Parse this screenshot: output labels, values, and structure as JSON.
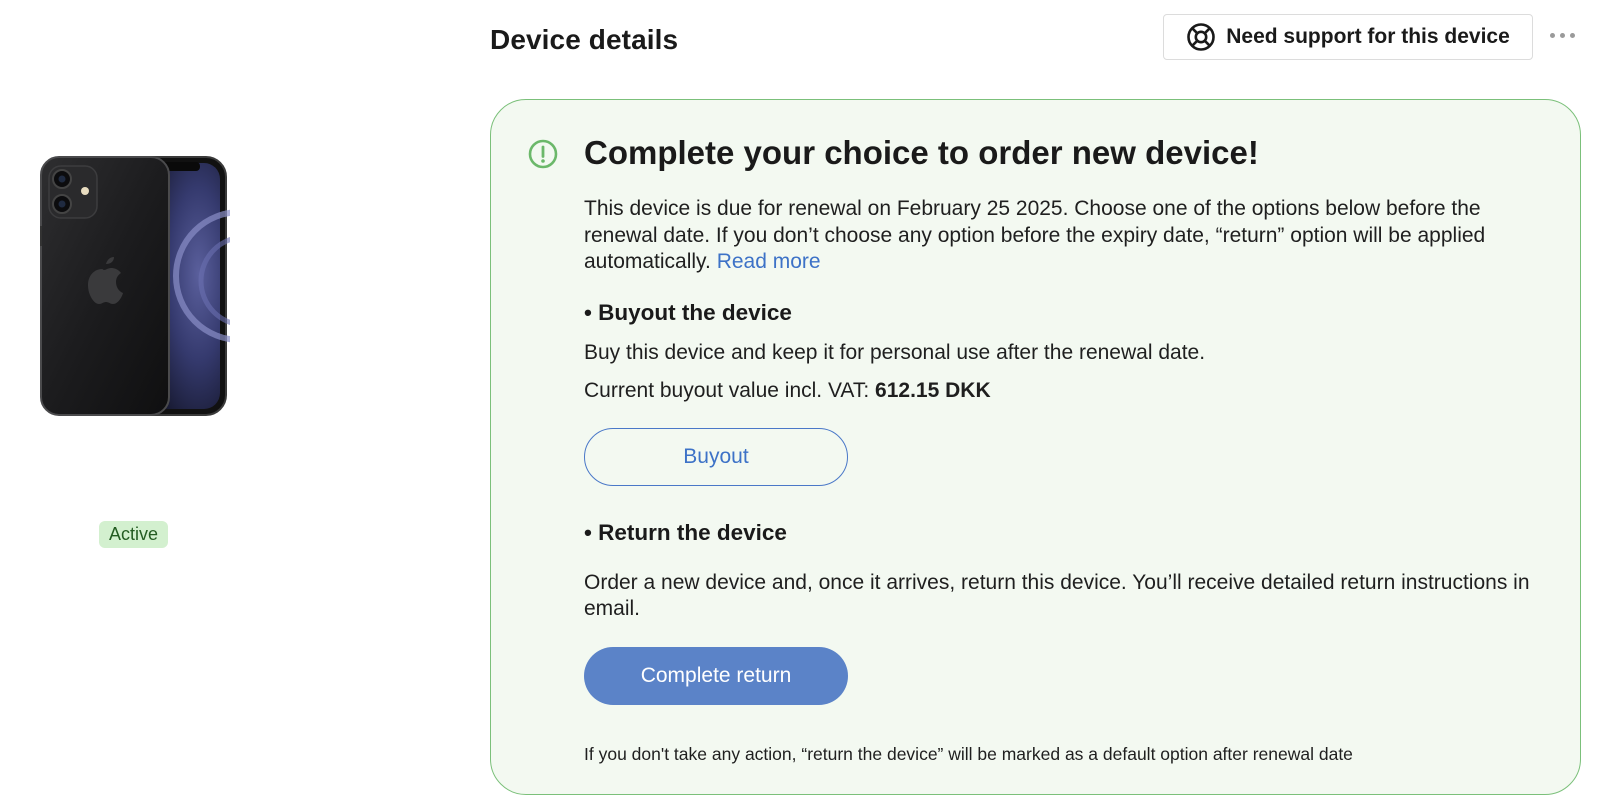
{
  "header": {
    "title": "Device details",
    "support_button_label": "Need support for this device",
    "support_icon": "lifebuoy-icon",
    "more_icon": "more-dots-icon"
  },
  "device": {
    "image_icon": "smartphone-image",
    "status": "Active",
    "status_color": "#d3f0cf"
  },
  "renewal_card": {
    "icon": "alert-circle-icon",
    "accent_color": "#7bc07a",
    "title": "Complete your choice to order new device!",
    "intro": "This device is due for renewal on February 25 2025. Choose one of the options below before the renewal date. If you don’t choose any option before the expiry date, “return” option will be applied automatically.",
    "read_more_label": "Read more",
    "buyout": {
      "heading": "•  Buyout the device",
      "description": "Buy this device and keep it for personal use after the renewal date.",
      "value_label": "Current buyout value incl. VAT:",
      "value": "612.15 DKK",
      "button_label": "Buyout"
    },
    "return": {
      "heading": "• Return the device",
      "description": "Order a new device and, once it arrives, return this device. You’ll receive detailed return instructions in email.",
      "button_label": "Complete return",
      "button_color": "#5b83c8"
    },
    "footnote": "If you don't take any action, “return the device” will be marked as a default option after renewal date"
  }
}
